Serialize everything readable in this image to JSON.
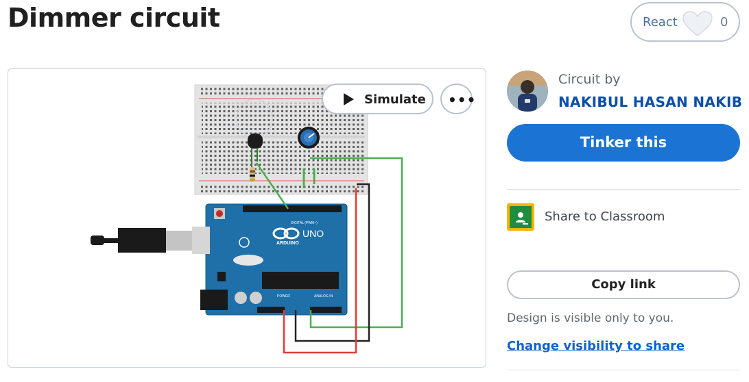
{
  "page": {
    "title": "Dimmer circuit"
  },
  "react": {
    "label": "React",
    "count": "0"
  },
  "canvas": {
    "simulate_label": "Simulate",
    "more_label": "•••",
    "arduino_logo": "ARDUINO",
    "arduino_model": "UNO",
    "digital_header": "DIGITAL (PWM~)",
    "power_label": "POWER",
    "analog_label": "ANALOG IN"
  },
  "author": {
    "prefix": "Circuit by",
    "name": "NAKIBUL HASAN NAKIB"
  },
  "actions": {
    "tinker_label": "Tinker this",
    "classroom_label": "Share to Classroom",
    "copy_link_label": "Copy link",
    "visibility_note": "Design is visible only to you.",
    "change_visibility_label": "Change visibility to share"
  },
  "colors": {
    "primary": "#1b74d4",
    "author_link": "#0d4fa8",
    "arduino_blue": "#1f6fa8",
    "wire_green": "#4caf50",
    "wire_red": "#e53935",
    "wire_black": "#222222",
    "classroom_yellow": "#f4b400",
    "classroom_green": "#1e8e3e"
  },
  "icons": {
    "react": "heart-icon",
    "simulate": "play-icon",
    "more": "more-dots-icon",
    "classroom": "google-classroom-icon"
  }
}
